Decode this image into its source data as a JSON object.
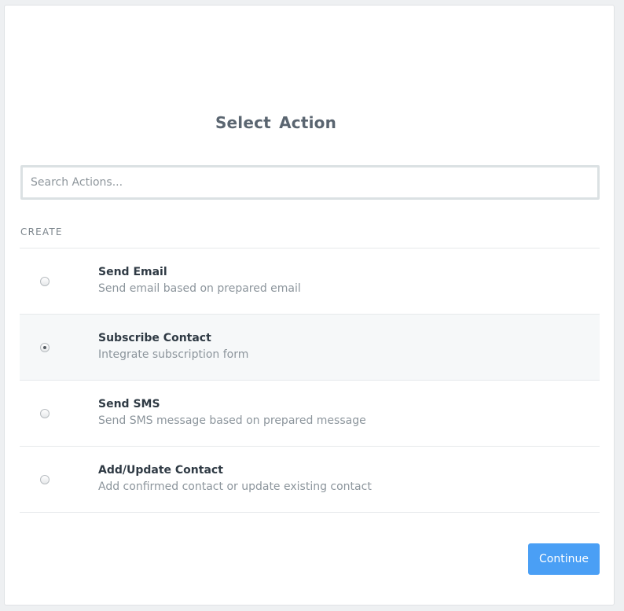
{
  "title": "Select Action",
  "search": {
    "placeholder": "Search Actions...",
    "value": ""
  },
  "section_label": "CREATE",
  "actions": [
    {
      "title": "Send Email",
      "description": "Send email based on prepared email",
      "selected": false
    },
    {
      "title": "Subscribe Contact",
      "description": "Integrate subscription form",
      "selected": true
    },
    {
      "title": "Send SMS",
      "description": "Send SMS message based on prepared message",
      "selected": false
    },
    {
      "title": "Add/Update Contact",
      "description": "Add confirmed contact or update existing contact",
      "selected": false
    }
  ],
  "continue_label": "Continue",
  "colors": {
    "accent": "#4a9ff5",
    "selected_row": "#f6f8f9"
  }
}
